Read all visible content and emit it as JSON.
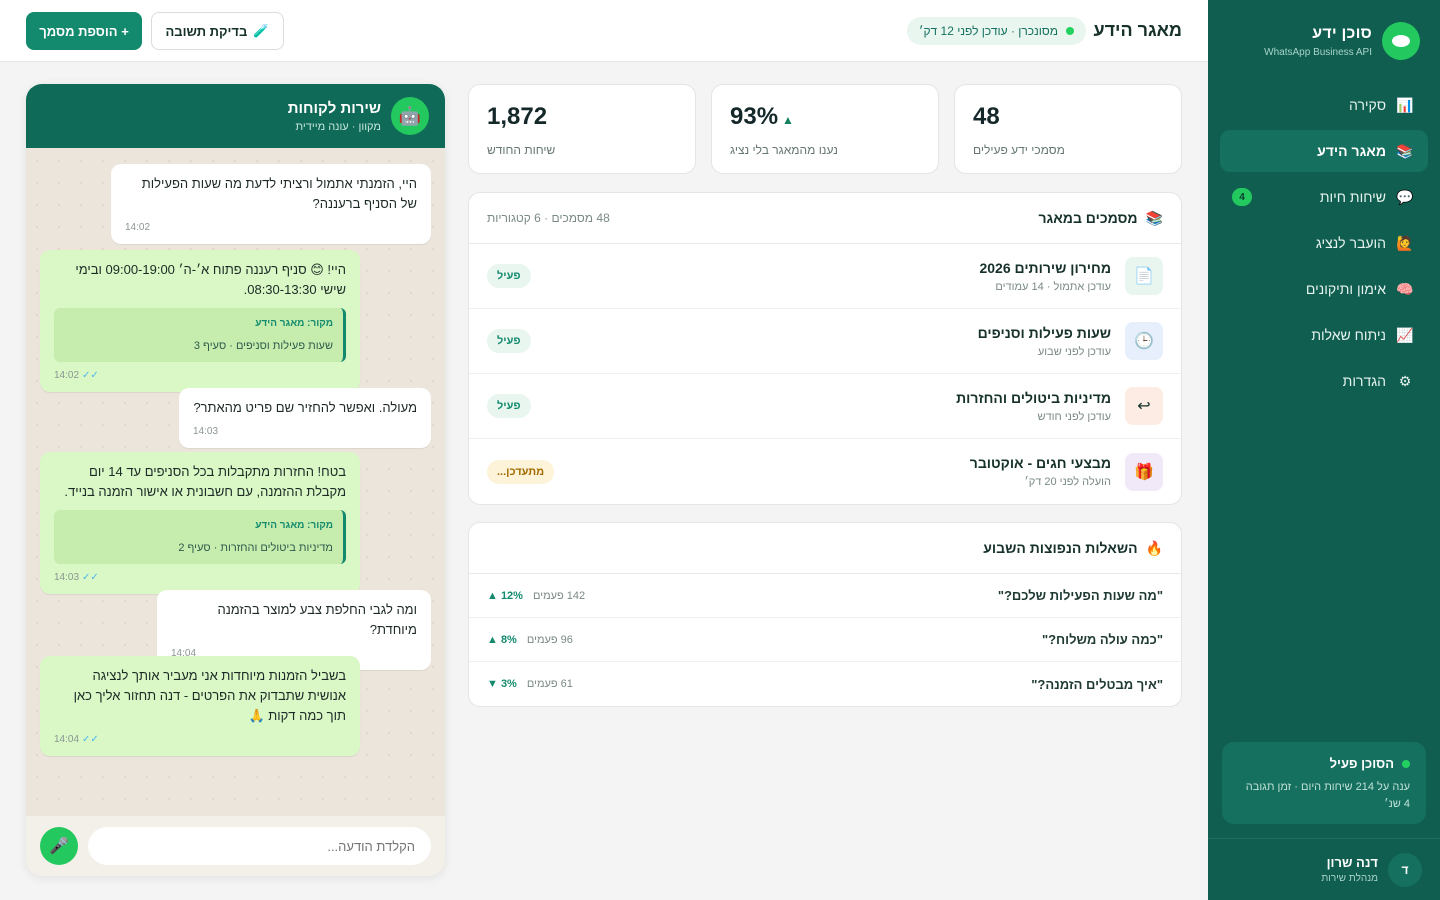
{
  "sidebar": {
    "brand_title": "סוכן ידע",
    "brand_sub": "WhatsApp Business API",
    "items": [
      {
        "label": "סקירה",
        "icon": "bar-chart-icon"
      },
      {
        "label": "מאגר הידע",
        "icon": "books-icon",
        "active": true
      },
      {
        "label": "שיחות חיות",
        "icon": "speech-bubble-icon",
        "badge": "4"
      },
      {
        "label": "הועבר לנציג",
        "icon": "person-raising-hand-icon"
      },
      {
        "label": "אימון ותיקונים",
        "icon": "brain-icon"
      },
      {
        "label": "ניתוח שאלות",
        "icon": "line-chart-icon"
      },
      {
        "label": "הגדרות",
        "icon": "gear-icon"
      }
    ],
    "agent_title": "הסוכן פעיל",
    "agent_sub": "ענה על 214 שיחות היום · זמן תגובה 4 שנ׳",
    "profile_initial": "ד",
    "profile_name": "דנה שרון",
    "profile_role": "מנהלת שירות"
  },
  "topbar": {
    "title": "מאגר הידע",
    "status": "מסונכרן · עודכן לפני 12 דק׳",
    "test_button": "בדיקת תשובה",
    "add_button": "+ הוספת מסמך"
  },
  "stats": [
    {
      "value": "48",
      "label": "מסמכי ידע פעילים"
    },
    {
      "value": "93%",
      "trend": "▲",
      "label": "נענו מהמאגר בלי נציג"
    },
    {
      "value": "1,872",
      "label": "שיחות החודש"
    }
  ],
  "documents": {
    "title": "מסמכים במאגר",
    "meta": "48 מסמכים · 6 קטגוריות",
    "items": [
      {
        "name": "מחירון שירותים 2026",
        "sub": "עודכן אתמול · 14 עמודים",
        "status": "פעיל",
        "state": "active",
        "icon": "document-icon"
      },
      {
        "name": "שעות פעילות וסניפים",
        "sub": "עודכן לפני שבוע",
        "status": "פעיל",
        "state": "active",
        "icon": "clock-icon"
      },
      {
        "name": "מדיניות ביטולים והחזרות",
        "sub": "עודכן לפני חודש",
        "status": "פעיל",
        "state": "active",
        "icon": "return-arrow-icon"
      },
      {
        "name": "מבצעי חגים - אוקטובר",
        "sub": "הועלה לפני 20 דק׳",
        "status": "מתעדכן...",
        "state": "updating",
        "icon": "gift-icon"
      }
    ]
  },
  "questions": {
    "title": "השאלות הנפוצות השבוע",
    "items": [
      {
        "text": "\"מה שעות הפעילות שלכם?\"",
        "count": "142 פעמים",
        "trend": "▲ 12%"
      },
      {
        "text": "\"כמה עולה משלוח?\"",
        "count": "96 פעמים",
        "trend": "▲ 8%"
      },
      {
        "text": "\"איך מבטלים הזמנה?\"",
        "count": "61 פעמים",
        "trend": "▼ 3%"
      }
    ]
  },
  "chat": {
    "name": "שירות לקוחות",
    "sub": "מקוון · עונה מיידית",
    "messages": [
      {
        "role": "user",
        "text": "היי, הזמנתי אתמול ורציתי לדעת מה שעות הפעילות של הסניף ברעננה?",
        "time": "14:02"
      },
      {
        "role": "bot",
        "text": "היי! 😊 סניף רעננה פתוח א׳-ה׳ 09:00-19:00 ובימי שישי 08:30-13:30.",
        "source_title": "מקור: מאגר הידע",
        "source_text": "שעות פעילות וסניפים · סעיף 3",
        "time": "14:02"
      },
      {
        "role": "user",
        "text": "מעולה. ואפשר להחזיר שם פריט מהאתר?",
        "time": "14:03"
      },
      {
        "role": "bot",
        "text": "בטח! החזרות מתקבלות בכל הסניפים עד 14 יום מקבלת ההזמנה, עם חשבונית או אישור הזמנה בנייד.",
        "source_title": "מקור: מאגר הידע",
        "source_text": "מדיניות ביטולים והחזרות · סעיף 2",
        "time": "14:03"
      },
      {
        "role": "user",
        "text": "ומה לגבי החלפת צבע למוצר בהזמנה מיוחדת?",
        "time": "14:04"
      },
      {
        "role": "bot",
        "text": "בשביל הזמנות מיוחדות אני מעביר אותך לנציגה אנושית שתבדוק את הפרטים - דנה תחזור אליך כאן תוך כמה דקות 🙏",
        "time": "14:04"
      }
    ],
    "input_placeholder": "הקלדת הודעה..."
  }
}
